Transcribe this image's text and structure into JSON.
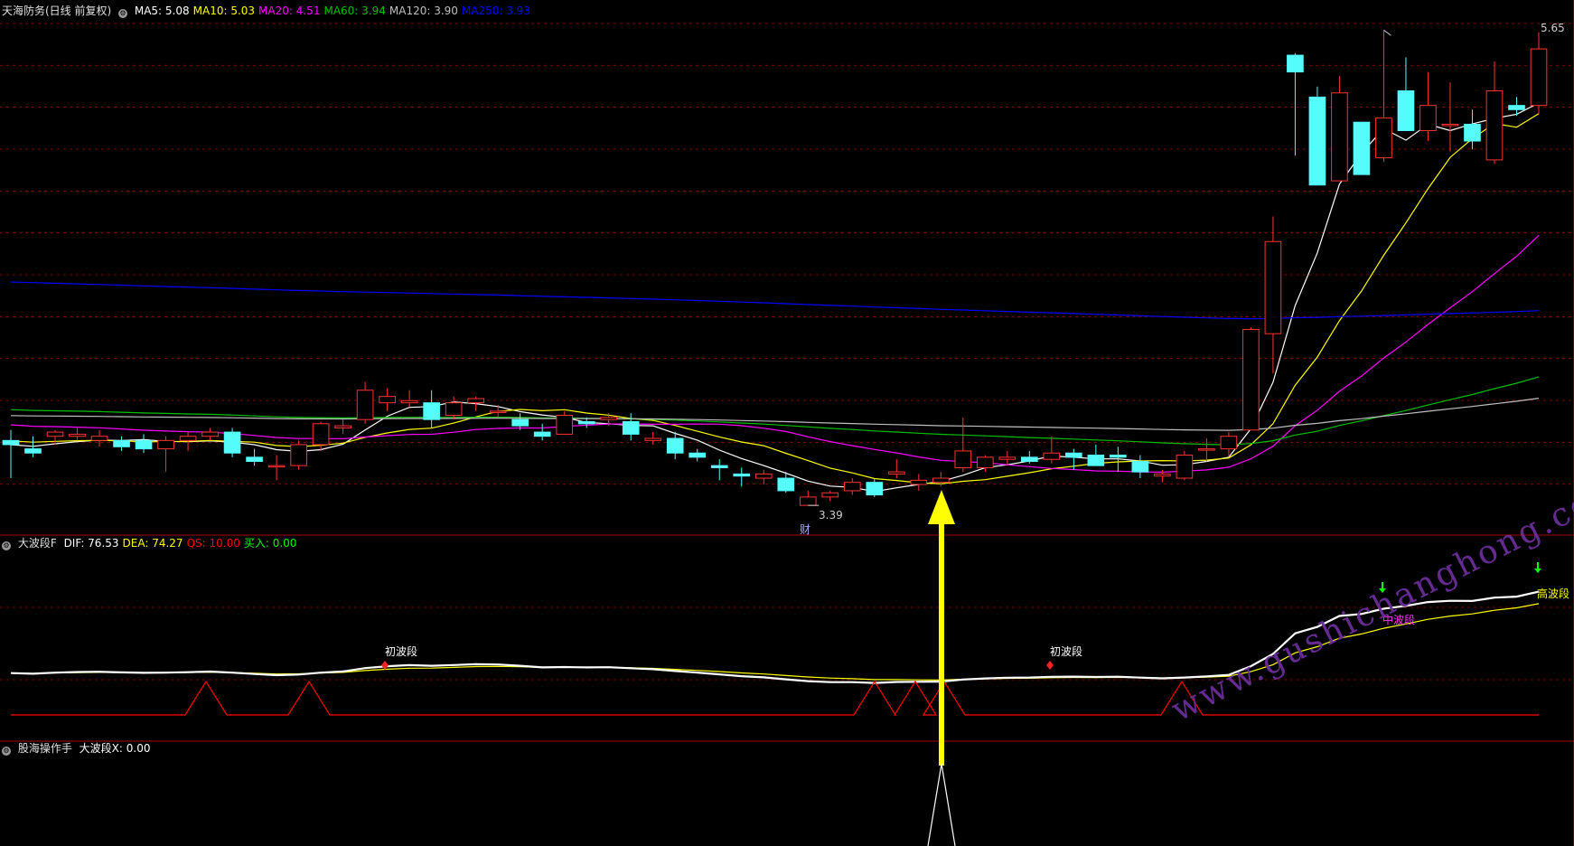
{
  "main_panel": {
    "stock_title": "天海防务(日线 前复权)",
    "indicators": [
      {
        "name": "MA5:",
        "value": "5.08",
        "color": "#ffffff"
      },
      {
        "name": "MA10:",
        "value": "5.03",
        "color": "#ffff00"
      },
      {
        "name": "MA20:",
        "value": "4.51",
        "color": "#ff00ff"
      },
      {
        "name": "MA60:",
        "value": "3.94",
        "color": "#00c000"
      },
      {
        "name": "MA120:",
        "value": "3.90",
        "color": "#c0c0c0"
      },
      {
        "name": "MA250:",
        "value": "3.93",
        "color": "#0000ff"
      }
    ],
    "max_label": "5.65",
    "min_label": "3.39",
    "event_marker": "财"
  },
  "sub_panel_1": {
    "indicator_name": "大波段F",
    "values": [
      {
        "name": "DIF:",
        "value": "76.53",
        "color": "#ffffff"
      },
      {
        "name": "DEA:",
        "value": "74.27",
        "color": "#ffff00"
      },
      {
        "name": "QS:",
        "value": "10.00",
        "color": "#ff0000"
      },
      {
        "name": "买入:",
        "value": "0.00",
        "color": "#00ff00"
      }
    ],
    "stage_labels": [
      "初波段",
      "初波段",
      "中波段",
      "高波段"
    ]
  },
  "sub_panel_2": {
    "indicator_name": "股海操作手",
    "values": [
      {
        "name": "大波段X:",
        "value": "0.00",
        "color": "#ffffff"
      }
    ]
  },
  "watermark": "www.gushichanghong.com",
  "colors": {
    "up": "#ff3232",
    "down": "#54fcfc",
    "grid": "#800000",
    "arrow": "#ffff00"
  },
  "chart_data": {
    "type": "candlestick",
    "ohlc": [
      [
        3.7,
        3.75,
        3.52,
        3.68
      ],
      [
        3.66,
        3.72,
        3.62,
        3.64
      ],
      [
        3.72,
        3.75,
        3.68,
        3.74
      ],
      [
        3.72,
        3.76,
        3.7,
        3.73
      ],
      [
        3.7,
        3.75,
        3.67,
        3.72
      ],
      [
        3.7,
        3.72,
        3.65,
        3.67
      ],
      [
        3.7,
        3.73,
        3.64,
        3.66
      ],
      [
        3.66,
        3.72,
        3.55,
        3.7
      ],
      [
        3.7,
        3.74,
        3.65,
        3.72
      ],
      [
        3.72,
        3.76,
        3.7,
        3.74
      ],
      [
        3.74,
        3.76,
        3.62,
        3.64
      ],
      [
        3.62,
        3.66,
        3.58,
        3.6
      ],
      [
        3.58,
        3.63,
        3.51,
        3.58
      ],
      [
        3.58,
        3.7,
        3.56,
        3.68
      ],
      [
        3.68,
        3.79,
        3.65,
        3.78
      ],
      [
        3.76,
        3.8,
        3.73,
        3.77
      ],
      [
        3.8,
        3.98,
        3.78,
        3.94
      ],
      [
        3.88,
        3.95,
        3.84,
        3.91
      ],
      [
        3.88,
        3.94,
        3.86,
        3.89
      ],
      [
        3.88,
        3.94,
        3.76,
        3.8
      ],
      [
        3.82,
        3.91,
        3.8,
        3.88
      ],
      [
        3.88,
        3.91,
        3.84,
        3.9
      ],
      [
        3.84,
        3.87,
        3.81,
        3.84
      ],
      [
        3.8,
        3.83,
        3.75,
        3.77
      ],
      [
        3.74,
        3.78,
        3.7,
        3.72
      ],
      [
        3.73,
        3.84,
        3.73,
        3.82
      ],
      [
        3.79,
        3.81,
        3.76,
        3.78
      ],
      [
        3.8,
        3.83,
        3.77,
        3.81
      ],
      [
        3.79,
        3.83,
        3.7,
        3.73
      ],
      [
        3.7,
        3.74,
        3.68,
        3.71
      ],
      [
        3.71,
        3.74,
        3.61,
        3.64
      ],
      [
        3.64,
        3.66,
        3.6,
        3.62
      ],
      [
        3.58,
        3.61,
        3.51,
        3.57
      ],
      [
        3.54,
        3.57,
        3.48,
        3.53
      ],
      [
        3.52,
        3.56,
        3.49,
        3.54
      ],
      [
        3.52,
        3.55,
        3.45,
        3.46
      ],
      [
        3.39,
        3.46,
        3.39,
        3.43
      ],
      [
        3.43,
        3.46,
        3.41,
        3.45
      ],
      [
        3.46,
        3.52,
        3.44,
        3.5
      ],
      [
        3.5,
        3.52,
        3.43,
        3.44
      ],
      [
        3.54,
        3.61,
        3.52,
        3.55
      ],
      [
        3.49,
        3.54,
        3.46,
        3.51
      ],
      [
        3.5,
        3.55,
        3.48,
        3.52
      ],
      [
        3.57,
        3.81,
        3.55,
        3.65
      ],
      [
        3.57,
        3.63,
        3.55,
        3.62
      ],
      [
        3.61,
        3.65,
        3.58,
        3.62
      ],
      [
        3.62,
        3.65,
        3.59,
        3.6
      ],
      [
        3.61,
        3.72,
        3.59,
        3.64
      ],
      [
        3.64,
        3.66,
        3.56,
        3.62
      ],
      [
        3.63,
        3.68,
        3.6,
        3.58
      ],
      [
        3.63,
        3.67,
        3.55,
        3.62
      ],
      [
        3.6,
        3.63,
        3.52,
        3.55
      ],
      [
        3.53,
        3.56,
        3.5,
        3.54
      ],
      [
        3.52,
        3.65,
        3.51,
        3.63
      ],
      [
        3.66,
        3.71,
        3.6,
        3.66
      ],
      [
        3.66,
        3.74,
        3.62,
        3.72
      ],
      [
        3.75,
        4.24,
        3.75,
        4.23
      ],
      [
        4.21,
        4.77,
        4.02,
        4.65
      ],
      [
        5.54,
        5.55,
        5.06,
        5.46
      ],
      [
        5.34,
        5.39,
        4.92,
        4.92
      ],
      [
        4.94,
        5.44,
        4.94,
        5.36
      ],
      [
        5.22,
        5.22,
        4.97,
        4.97
      ],
      [
        5.05,
        5.66,
        5.03,
        5.24
      ],
      [
        5.37,
        5.53,
        5.18,
        5.18
      ],
      [
        5.18,
        5.46,
        5.13,
        5.3
      ],
      [
        5.21,
        5.41,
        5.08,
        5.21
      ],
      [
        5.21,
        5.28,
        5.09,
        5.13
      ],
      [
        5.04,
        5.51,
        5.02,
        5.37
      ],
      [
        5.3,
        5.34,
        5.25,
        5.28
      ],
      [
        5.3,
        5.65,
        5.26,
        5.57
      ]
    ],
    "x_axis_label": "",
    "y_axis_label": "",
    "ma_lines": [
      "MA5",
      "MA10",
      "MA20",
      "MA60",
      "MA120",
      "MA250"
    ],
    "ylim": [
      3.3,
      5.7
    ],
    "grid": true
  }
}
